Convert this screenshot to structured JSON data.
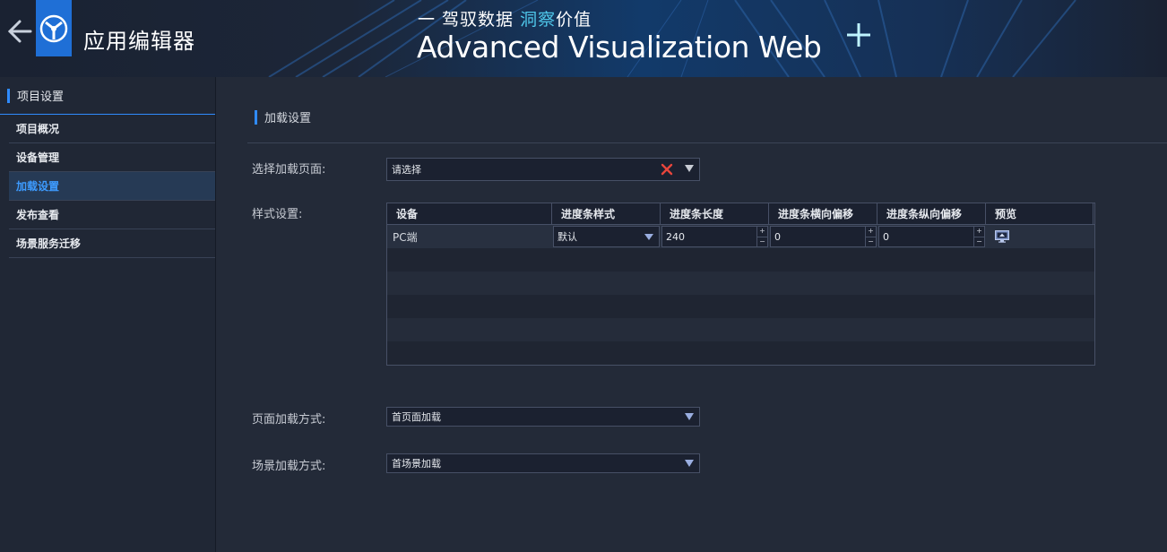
{
  "header": {
    "app_title": "应用编辑器",
    "slogan_prefix": "一 驾驭数据 ",
    "slogan_highlight": "洞察",
    "slogan_suffix": "价值",
    "brand": "Advanced Visualization Web",
    "accent_color": "#1f6fd6"
  },
  "sidebar": {
    "heading": "项目设置",
    "items": [
      {
        "label": "项目概况",
        "active": false
      },
      {
        "label": "设备管理",
        "active": false
      },
      {
        "label": "加载设置",
        "active": true
      },
      {
        "label": "发布查看",
        "active": false
      },
      {
        "label": "场景服务迁移",
        "active": false
      }
    ]
  },
  "main": {
    "section_title": "加载设置",
    "select_page": {
      "label": "选择加载页面:",
      "placeholder": "请选择"
    },
    "style_label": "样式设置:",
    "table": {
      "columns": [
        "设备",
        "进度条样式",
        "进度条长度",
        "进度条横向偏移",
        "进度条纵向偏移",
        "预览"
      ],
      "rows": [
        {
          "device": "PC端",
          "style": "默认",
          "length": "240",
          "h_offset": "0",
          "v_offset": "0"
        }
      ]
    },
    "page_load": {
      "label": "页面加载方式:",
      "value": "首页面加载"
    },
    "scene_load": {
      "label": "场景加载方式:",
      "value": "首场景加载"
    }
  },
  "icons": {
    "back": "arrow-left-icon",
    "logo": "logo-icon",
    "clear": "clear-x-icon",
    "preview": "monitor-icon"
  }
}
